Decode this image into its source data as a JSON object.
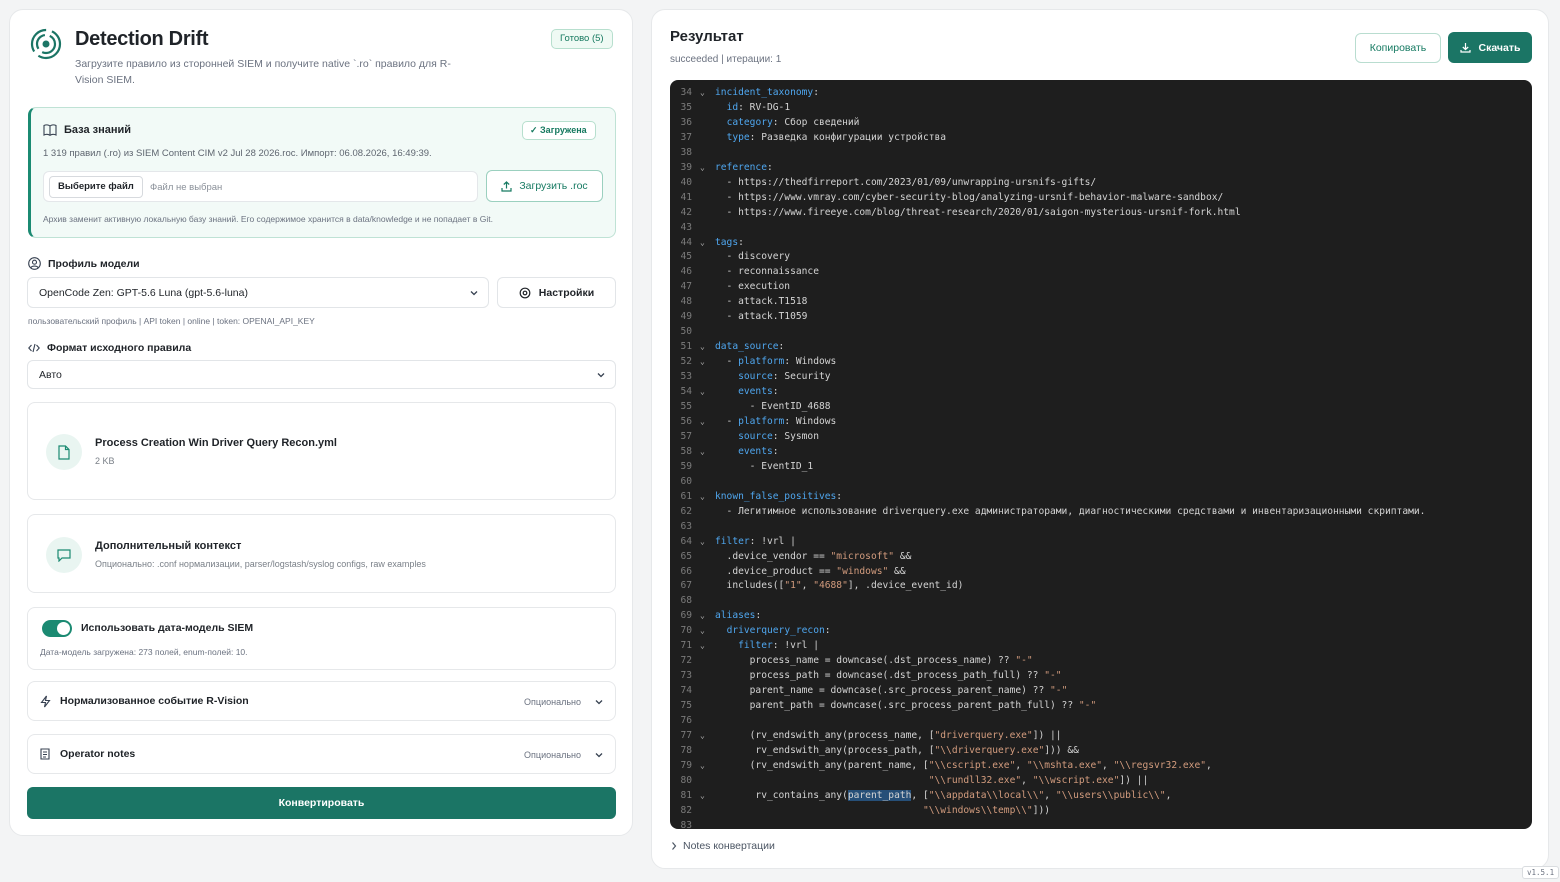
{
  "app": {
    "title": "Detection Drift",
    "subtitle": "Загрузите правило из сторонней SIEM и получите native `.ro` правило для R-Vision SIEM.",
    "ready_badge": "Готово (5)"
  },
  "knowledge": {
    "title": "База знаний",
    "badge": "Загружена",
    "meta": "1 319 правил (.ro) из SIEM Content CIM v2 Jul 28 2026.roc. Импорт: 06.08.2026, 16:49:39.",
    "file_button": "Выберите файл",
    "file_none": "Файл не выбран",
    "upload_button": "Загрузить .roc",
    "note": "Архив заменит активную локальную базу знаний. Его содержимое хранится в data/knowledge и не попадает в Git."
  },
  "profile": {
    "label": "Профиль модели",
    "selected": "OpenCode Zen: GPT-5.6 Luna (gpt-5.6-luna)",
    "settings_button": "Настройки",
    "hint": "пользовательский профиль | API token | online | token: OPENAI_API_KEY"
  },
  "format": {
    "label": "Формат исходного правила",
    "selected": "Авто"
  },
  "file_card": {
    "name": "Process Creation Win Driver Query Recon.yml",
    "size": "2 KB"
  },
  "context_card": {
    "title": "Дополнительный контекст",
    "subtitle": "Опционально: .conf нормализации, parser/logstash/syslog configs, raw examples"
  },
  "datamodel": {
    "label": "Использовать дата-модель SIEM",
    "enabled": true,
    "status": "Дата-модель загружена: 273 полей, enum-полей: 10."
  },
  "normalized_event": {
    "title": "Нормализованное событие R-Vision",
    "optional": "Опционально"
  },
  "operator_notes": {
    "title": "Operator notes",
    "optional": "Опционально"
  },
  "convert_button": "Конвертировать",
  "result": {
    "title": "Результат",
    "status": "succeeded | итерации: 1",
    "copy_button": "Копировать",
    "download_button": "Скачать",
    "notes_toggle": "Notes конвертации",
    "code_lines": [
      {
        "n": "34",
        "fold": true,
        "html": "<span class=\"k\">incident_taxonomy</span>:"
      },
      {
        "n": "35",
        "fold": false,
        "html": "  <span class=\"k\">id</span>: RV-DG-1"
      },
      {
        "n": "36",
        "fold": false,
        "html": "  <span class=\"k\">category</span>: Сбор сведений"
      },
      {
        "n": "37",
        "fold": false,
        "html": "  <span class=\"k\">type</span>: Разведка конфигурации устройства"
      },
      {
        "n": "38",
        "fold": false,
        "html": ""
      },
      {
        "n": "39",
        "fold": true,
        "html": "<span class=\"k\">reference</span>:"
      },
      {
        "n": "40",
        "fold": false,
        "html": "  - https://thedfirreport.com/2023/01/09/unwrapping-ursnifs-gifts/"
      },
      {
        "n": "41",
        "fold": false,
        "html": "  - https://www.vmray.com/cyber-security-blog/analyzing-ursnif-behavior-malware-sandbox/"
      },
      {
        "n": "42",
        "fold": false,
        "html": "  - https://www.fireeye.com/blog/threat-research/2020/01/saigon-mysterious-ursnif-fork.html"
      },
      {
        "n": "43",
        "fold": false,
        "html": ""
      },
      {
        "n": "44",
        "fold": true,
        "html": "<span class=\"k\">tags</span>:"
      },
      {
        "n": "45",
        "fold": false,
        "html": "  - discovery"
      },
      {
        "n": "46",
        "fold": false,
        "html": "  - reconnaissance"
      },
      {
        "n": "47",
        "fold": false,
        "html": "  - execution"
      },
      {
        "n": "48",
        "fold": false,
        "html": "  - attack.T1518"
      },
      {
        "n": "49",
        "fold": false,
        "html": "  - attack.T1059"
      },
      {
        "n": "50",
        "fold": false,
        "html": ""
      },
      {
        "n": "51",
        "fold": true,
        "html": "<span class=\"k\">data_source</span>:"
      },
      {
        "n": "52",
        "fold": true,
        "html": "  - <span class=\"k\">platform</span>: Windows"
      },
      {
        "n": "53",
        "fold": false,
        "html": "    <span class=\"k\">source</span>: Security"
      },
      {
        "n": "54",
        "fold": true,
        "html": "    <span class=\"k\">events</span>:"
      },
      {
        "n": "55",
        "fold": false,
        "html": "      - EventID_4688"
      },
      {
        "n": "56",
        "fold": true,
        "html": "  - <span class=\"k\">platform</span>: Windows"
      },
      {
        "n": "57",
        "fold": false,
        "html": "    <span class=\"k\">source</span>: Sysmon"
      },
      {
        "n": "58",
        "fold": true,
        "html": "    <span class=\"k\">events</span>:"
      },
      {
        "n": "59",
        "fold": false,
        "html": "      - EventID_1"
      },
      {
        "n": "60",
        "fold": false,
        "html": ""
      },
      {
        "n": "61",
        "fold": true,
        "html": "<span class=\"k\">known_false_positives</span>:"
      },
      {
        "n": "62",
        "fold": false,
        "html": "  - Легитимное использование driverquery.exe администраторами, диагностическими средствами и инвентаризационными скриптами."
      },
      {
        "n": "63",
        "fold": false,
        "html": ""
      },
      {
        "n": "64",
        "fold": true,
        "html": "<span class=\"k\">filter</span>: !vrl |"
      },
      {
        "n": "65",
        "fold": false,
        "html": "  .device_vendor == <span class=\"s\">\"microsoft\"</span> &amp;&amp;"
      },
      {
        "n": "66",
        "fold": false,
        "html": "  .device_product == <span class=\"s\">\"windows\"</span> &amp;&amp;"
      },
      {
        "n": "67",
        "fold": false,
        "html": "  includes([<span class=\"s\">\"1\"</span>, <span class=\"s\">\"4688\"</span>], .device_event_id)"
      },
      {
        "n": "68",
        "fold": false,
        "html": ""
      },
      {
        "n": "69",
        "fold": true,
        "html": "<span class=\"k\">aliases</span>:"
      },
      {
        "n": "70",
        "fold": true,
        "html": "  <span class=\"k\">driverquery_recon</span>:"
      },
      {
        "n": "71",
        "fold": true,
        "html": "    <span class=\"k\">filter</span>: !vrl |"
      },
      {
        "n": "72",
        "fold": false,
        "html": "      process_name = downcase(.dst_process_name) ?? <span class=\"s\">\"-\"</span>"
      },
      {
        "n": "73",
        "fold": false,
        "html": "      process_path = downcase(.dst_process_path_full) ?? <span class=\"s\">\"-\"</span>"
      },
      {
        "n": "74",
        "fold": false,
        "html": "      parent_name = downcase(.src_process_parent_name) ?? <span class=\"s\">\"-\"</span>"
      },
      {
        "n": "75",
        "fold": false,
        "html": "      parent_path = downcase(.src_process_parent_path_full) ?? <span class=\"s\">\"-\"</span>"
      },
      {
        "n": "76",
        "fold": false,
        "html": ""
      },
      {
        "n": "77",
        "fold": true,
        "html": "      (rv_endswith_any(process_name, [<span class=\"s\">\"driverquery.exe\"</span>]) ||"
      },
      {
        "n": "78",
        "fold": false,
        "html": "       rv_endswith_any(process_path, [<span class=\"s\">\"\\\\driverquery.exe\"</span>])) &amp;&amp;"
      },
      {
        "n": "79",
        "fold": true,
        "html": "      (rv_endswith_any(parent_name, [<span class=\"s\">\"\\\\cscript.exe\"</span>, <span class=\"s\">\"\\\\mshta.exe\"</span>, <span class=\"s\">\"\\\\regsvr32.exe\"</span>,"
      },
      {
        "n": "80",
        "fold": false,
        "html": "                                     <span class=\"s\">\"\\\\rundll32.exe\"</span>, <span class=\"s\">\"\\\\wscript.exe\"</span>]) ||"
      },
      {
        "n": "81",
        "fold": true,
        "html": "       rv_contains_any(<span class=\"hl\">parent_path</span>, [<span class=\"s\">\"\\\\appdata\\\\local\\\\\"</span>, <span class=\"s\">\"\\\\users\\\\public\\\\\"</span>,"
      },
      {
        "n": "82",
        "fold": false,
        "html": "                                    <span class=\"s\">\"\\\\windows\\\\temp\\\\\"</span>]))"
      },
      {
        "n": "83",
        "fold": false,
        "html": ""
      }
    ]
  },
  "version": "v1.5.1",
  "colors": {
    "accent": "#1b7565",
    "accent_light": "#e9f5f1",
    "code_bg": "#1e1e1e",
    "code_key": "#4fa6ee",
    "code_string": "#d39c7e"
  }
}
